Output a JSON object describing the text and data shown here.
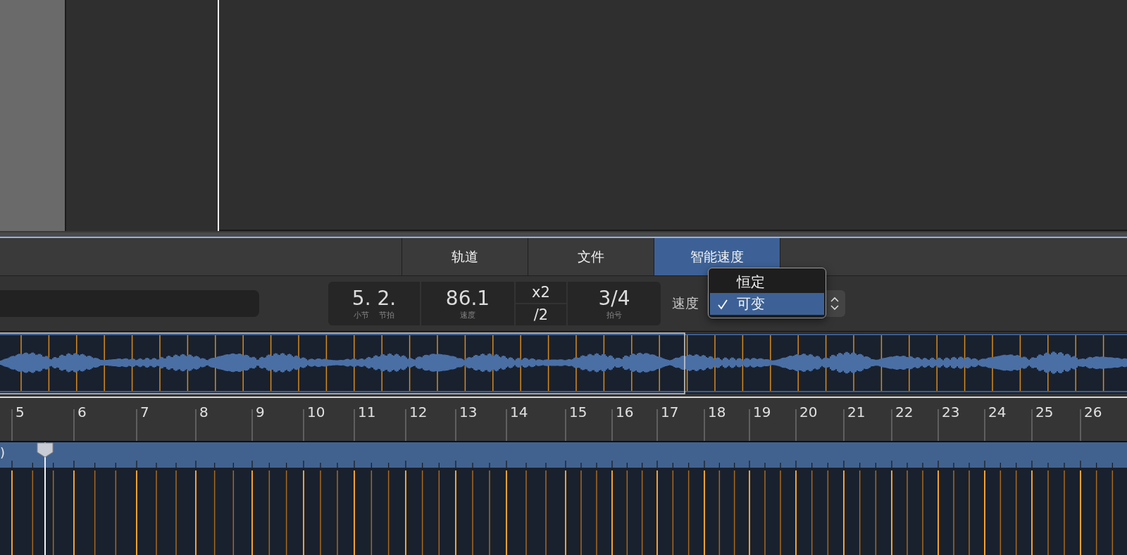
{
  "tabs": [
    {
      "label": "轨道",
      "selected": false
    },
    {
      "label": "文件",
      "selected": false
    },
    {
      "label": "智能速度",
      "selected": true
    }
  ],
  "lcd": {
    "position": {
      "value": "5. 2.",
      "labels": [
        "小节",
        "节拍"
      ]
    },
    "tempo": {
      "value": "86.1",
      "label": "速度"
    },
    "multiplier": {
      "double": "x2",
      "half": "/2"
    },
    "signature": {
      "value": "3/4",
      "label": "拍号"
    }
  },
  "tempo_mode": {
    "label": "速度",
    "menu": [
      {
        "label": "恒定",
        "selected": false
      },
      {
        "label": "可变",
        "selected": true
      }
    ]
  },
  "ruler": {
    "bars": [
      "5",
      "6",
      "7",
      "8",
      "9",
      "10",
      "11",
      "12",
      "13",
      "14",
      "15",
      "16",
      "17",
      "18",
      "19",
      "20",
      "21",
      "22",
      "23",
      "24",
      "25",
      "26"
    ]
  },
  "tempo_track": {
    "label": ")"
  }
}
